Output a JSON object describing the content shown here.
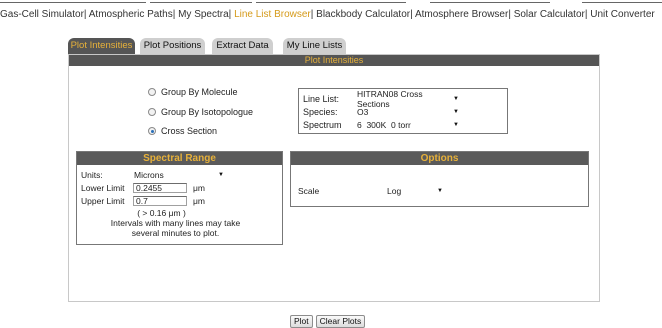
{
  "nav": {
    "items": [
      {
        "label": "Gas-Cell Simulator",
        "active": false
      },
      {
        "label": "Atmospheric Paths",
        "active": false
      },
      {
        "label": "My Spectra",
        "active": false
      },
      {
        "label": "Line List Browser",
        "active": true
      },
      {
        "label": "Blackbody Calculator",
        "active": false
      },
      {
        "label": "Atmosphere Browser",
        "active": false
      },
      {
        "label": "Solar Calculator",
        "active": false
      },
      {
        "label": "Unit Converter",
        "active": false
      }
    ],
    "separator": "|"
  },
  "tabs": [
    {
      "label": "Plot Intensities",
      "active": true
    },
    {
      "label": "Plot Positions",
      "active": false
    },
    {
      "label": "Extract Data",
      "active": false
    },
    {
      "label": "My Line Lists",
      "active": false
    }
  ],
  "panel": {
    "title": "Plot Intensities",
    "grouping": {
      "options": [
        {
          "label": "Group By Molecule",
          "checked": false
        },
        {
          "label": "Group By Isotopologue",
          "checked": false
        },
        {
          "label": "Cross Section",
          "checked": true
        }
      ]
    },
    "linelist": {
      "line_list_label": "Line List:",
      "line_list_value": "HITRAN08 Cross Sections",
      "species_label": "Species:",
      "species_value": "O3",
      "spectrum_label": "Spectrum",
      "spectrum_value": "6  300K  0 torr"
    },
    "spectral_range": {
      "title": "Spectral Range",
      "units_label": "Units:",
      "units_value": "Microns",
      "lower_label": "Lower Limit",
      "lower_value": "0.2455",
      "upper_label": "Upper Limit",
      "upper_value": "0.7",
      "unit": "μm",
      "range_note": "( > 0.16 μm )",
      "warning_line1": "Intervals with many lines may take",
      "warning_line2": "several minutes to plot."
    },
    "options": {
      "title": "Options",
      "scale_label": "Scale",
      "scale_value": "Log"
    }
  },
  "buttons": {
    "plot": "Plot",
    "clear": "Clear Plots"
  },
  "colors": {
    "accent": "#e7b13a",
    "header_bg": "#555555",
    "nav_active": "#d59a1a"
  }
}
